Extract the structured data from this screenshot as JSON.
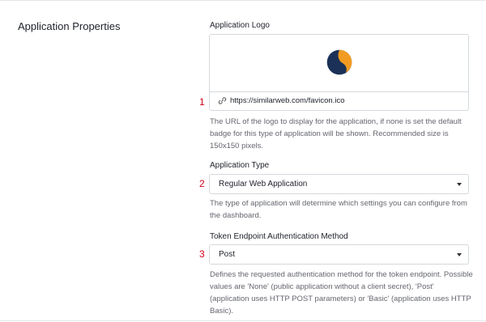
{
  "section": {
    "title": "Application Properties"
  },
  "logo": {
    "label": "Application Logo",
    "marker": "1",
    "url": "https://similarweb.com/favicon.ico",
    "help": "The URL of the logo to display for the application, if none is set the default badge for this type of application will be shown. Recommended size is 150x150 pixels.",
    "preview_colors": {
      "navy": "#1b3157",
      "orange": "#f29b22"
    },
    "link_icon": "link-icon"
  },
  "app_type": {
    "label": "Application Type",
    "marker": "2",
    "value": "Regular Web Application",
    "help": "The type of application will determine which settings you can configure from the dashboard."
  },
  "token_auth": {
    "label": "Token Endpoint Authentication Method",
    "marker": "3",
    "value": "Post",
    "help": "Defines the requested authentication method for the token endpoint. Possible values are 'None' (public application without a client secret), 'Post' (application uses HTTP POST parameters) or 'Basic' (application uses HTTP Basic)."
  },
  "colors": {
    "marker": "#d0021b",
    "help_text": "#65676e",
    "border": "#d5d8dd"
  }
}
